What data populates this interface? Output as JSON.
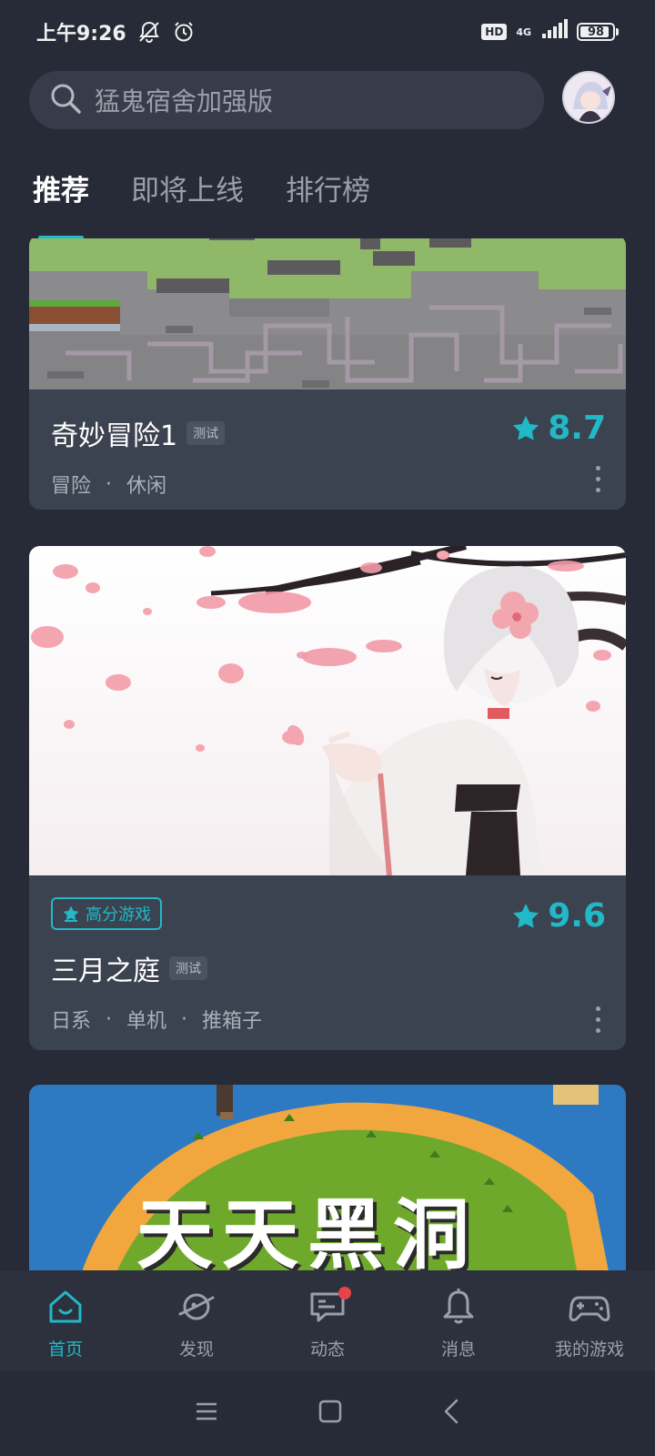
{
  "status_bar": {
    "time": "上午9:26",
    "hd": "HD",
    "network": "4G",
    "battery": "98"
  },
  "search": {
    "placeholder": "猛鬼宿舍加强版"
  },
  "tabs": [
    {
      "label": "推荐",
      "active": true
    },
    {
      "label": "即将上线",
      "active": false
    },
    {
      "label": "排行榜",
      "active": false
    }
  ],
  "games": [
    {
      "title": "奇妙冒险1",
      "tag": "测试",
      "categories": [
        "冒险",
        "休闲"
      ],
      "rating": "8.7"
    },
    {
      "badge": "高分游戏",
      "title": "三月之庭",
      "tag": "测试",
      "categories": [
        "日系",
        "单机",
        "推箱子"
      ],
      "rating": "9.6"
    },
    {
      "cover_text": "天天黑洞"
    }
  ],
  "bottom_nav": [
    {
      "label": "首页",
      "icon": "home-icon",
      "active": true
    },
    {
      "label": "发现",
      "icon": "planet-icon",
      "active": false
    },
    {
      "label": "动态",
      "icon": "chat-icon",
      "active": false,
      "unread": true
    },
    {
      "label": "消息",
      "icon": "bell-icon",
      "active": false
    },
    {
      "label": "我的游戏",
      "icon": "gamepad-icon",
      "active": false
    }
  ],
  "colors": {
    "accent": "#21b8c8",
    "background": "#262b37",
    "card": "#3c4350",
    "unread": "#e8434b"
  }
}
